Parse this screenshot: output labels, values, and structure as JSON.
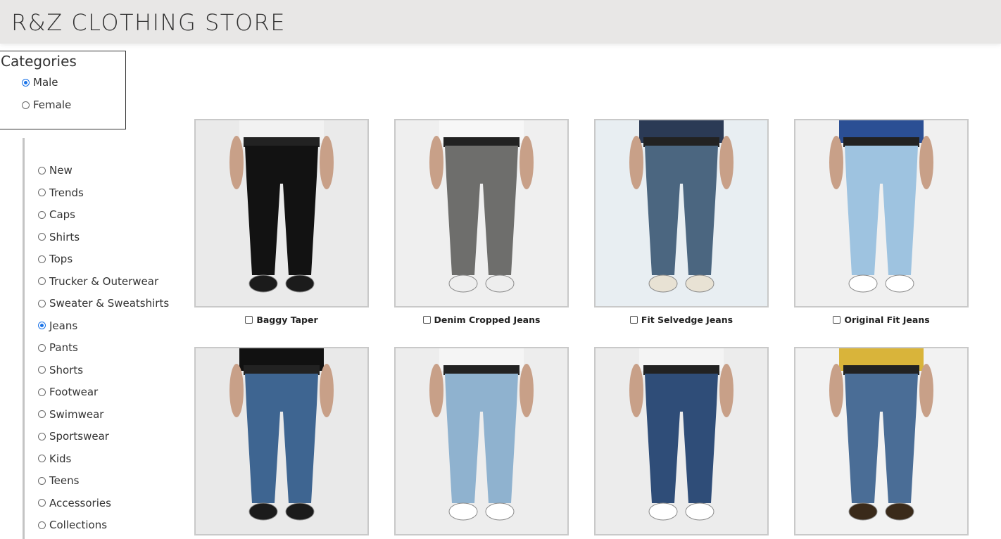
{
  "header": {
    "title": "R&Z CLOTHING STORE"
  },
  "categories": {
    "title": "Categories",
    "gender": [
      {
        "label": "Male",
        "checked": true
      },
      {
        "label": "Female",
        "checked": false
      }
    ],
    "items": [
      {
        "label": "New",
        "checked": false
      },
      {
        "label": "Trends",
        "checked": false
      },
      {
        "label": "Caps",
        "checked": false
      },
      {
        "label": "Shirts",
        "checked": false
      },
      {
        "label": "Tops",
        "checked": false
      },
      {
        "label": "Trucker & Outerwear",
        "checked": false
      },
      {
        "label": "Sweater & Sweatshirts",
        "checked": false
      },
      {
        "label": "Jeans",
        "checked": true
      },
      {
        "label": "Pants",
        "checked": false
      },
      {
        "label": "Shorts",
        "checked": false
      },
      {
        "label": "Footwear",
        "checked": false
      },
      {
        "label": "Swimwear",
        "checked": false
      },
      {
        "label": "Sportswear",
        "checked": false
      },
      {
        "label": "Kids",
        "checked": false
      },
      {
        "label": "Teens",
        "checked": false
      },
      {
        "label": "Accessories",
        "checked": false
      },
      {
        "label": "Collections",
        "checked": false
      }
    ]
  },
  "products": [
    {
      "name": "Baggy Taper",
      "jeans": "#121212",
      "top": "#f2f2f2",
      "bg": "#eaeaea",
      "shoe": "#1b1b1b"
    },
    {
      "name": "Denim Cropped Jeans",
      "jeans": "#6e6e6c",
      "top": "#f7f7f7",
      "bg": "#efefef",
      "shoe": "#eeeeee"
    },
    {
      "name": "Fit Selvedge Jeans",
      "jeans": "#4b6680",
      "top": "#2b3a55",
      "bg": "#e8eef2",
      "shoe": "#e8e2d4"
    },
    {
      "name": "Original Fit Jeans",
      "jeans": "#9ec3e0",
      "top": "#2b4f94",
      "bg": "#f0f0f0",
      "shoe": "#ffffff"
    },
    {
      "name": "",
      "jeans": "#3e6591",
      "top": "#111111",
      "bg": "#e9e9e9",
      "shoe": "#1b1b1b"
    },
    {
      "name": "",
      "jeans": "#8fb2cf",
      "top": "#f5f5f5",
      "bg": "#ededed",
      "shoe": "#ffffff"
    },
    {
      "name": "",
      "jeans": "#2f4d78",
      "top": "#f4f4f4",
      "bg": "#ececec",
      "shoe": "#ffffff"
    },
    {
      "name": "",
      "jeans": "#4a6d96",
      "top": "#d9b43a",
      "bg": "#f2f2f2",
      "shoe": "#3a2a1a"
    }
  ]
}
